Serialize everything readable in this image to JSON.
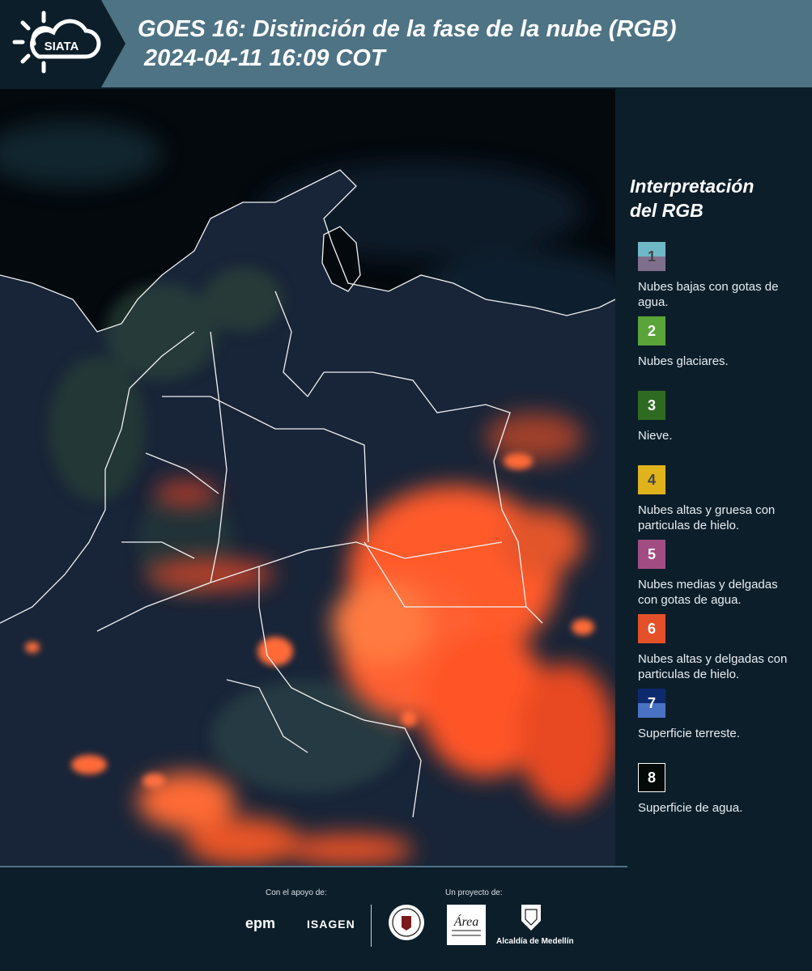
{
  "header": {
    "logo_text": "SIATA",
    "title_line1": "GOES 16: Distinción de la fase de la nube (RGB)",
    "title_line2": "2024-04-11 16:09 COT"
  },
  "legend": {
    "title_line1": "Interpretación",
    "title_line2": "del RGB",
    "items": [
      {
        "number": "1",
        "label": "Nubes bajas con gotas de agua.",
        "color_top": "#6fb8c8",
        "color_bottom": "#7f6f8c",
        "number_color": "#444444"
      },
      {
        "number": "2",
        "label": "Nubes glaciares.",
        "color": "#5aa43a",
        "number_color": "#ffffff"
      },
      {
        "number": "3",
        "label": "Nieve.",
        "color": "#2f6a22",
        "number_color": "#ffffff"
      },
      {
        "number": "4",
        "label": "Nubes altas y gruesa con particulas de hielo.",
        "color": "#e0b21c",
        "number_color": "#444444"
      },
      {
        "number": "5",
        "label": "Nubes medias y delgadas con gotas de agua.",
        "color": "#a24c84",
        "number_color": "#ffffff"
      },
      {
        "number": "6",
        "label": "Nubes altas y delgadas con particulas de hielo.",
        "color": "#e4502a",
        "number_color": "#ffffff"
      },
      {
        "number": "7",
        "label": "Superficie terreste.",
        "color_top": "#0e2a6e",
        "color_bottom": "#4a72c4",
        "number_color": "#ffffff"
      },
      {
        "number": "8",
        "label": "Superficie de agua.",
        "color": "#050a08",
        "number_color": "#ffffff",
        "border": "#ffffff"
      }
    ]
  },
  "footer": {
    "support_label": "Con el apoyo de:",
    "project_label": "Un proyecto de:",
    "sponsors": [
      "epm",
      "ISAGEN"
    ],
    "area_logo_text": "Área",
    "alcaldia_label": "Alcaldía de Medellín"
  },
  "colors": {
    "background": "#0c1e2a",
    "header_band": "#4e7384",
    "cloud_ice": "#ff5a2a",
    "land": "#1d2a44",
    "water": "#04090e"
  }
}
